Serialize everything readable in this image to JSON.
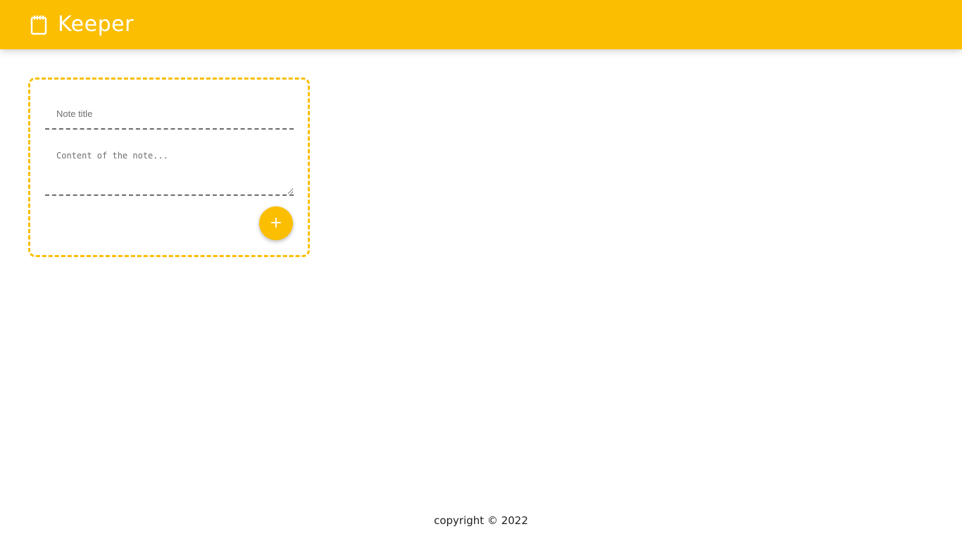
{
  "header": {
    "title": "Keeper",
    "icon": "notepad-icon",
    "background_color": "#fbbe01"
  },
  "note_form": {
    "title_placeholder": "Note title",
    "title_value": "",
    "content_placeholder": "Content of the note...",
    "content_value": "",
    "add_button_label": "+",
    "border_color": "#fbbe01"
  },
  "footer": {
    "text": "copyright © 2022"
  }
}
